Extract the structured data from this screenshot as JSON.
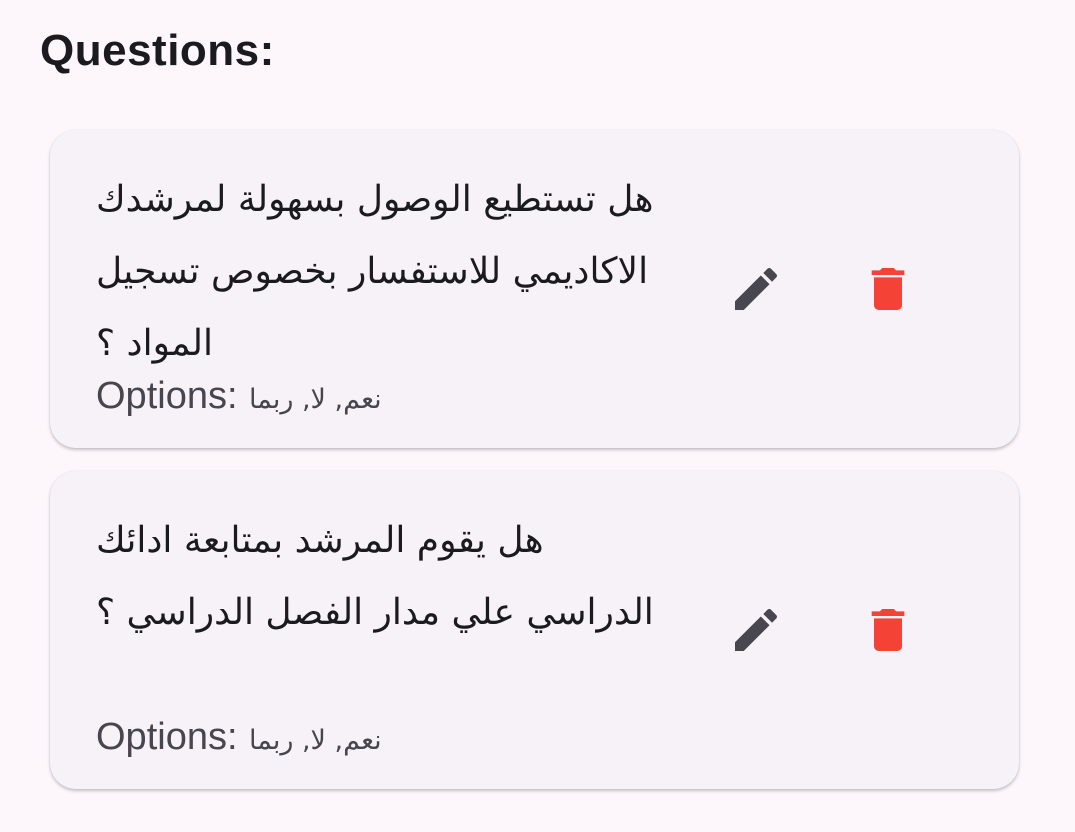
{
  "page": {
    "heading": "Questions:"
  },
  "questions": [
    {
      "text": "هل تستطيع الوصول بسهولة لمرشدك الاكاديمي للاستفسار بخصوص تسجيل المواد ؟",
      "options_label": "Options:",
      "options_values": "نعم, لا, ربما"
    },
    {
      "text": "هل يقوم المرشد بمتابعة ادائك الدراسي علي مدار الفصل الدراسي ؟",
      "options_label": "Options:",
      "options_values": "نعم, لا, ربما"
    }
  ],
  "icons": {
    "edit": "pencil-icon",
    "delete": "trash-icon"
  },
  "colors": {
    "background": "#fdf7fc",
    "card": "#f6f2f7",
    "edit_icon": "#48464f",
    "delete_icon": "#f44336"
  }
}
